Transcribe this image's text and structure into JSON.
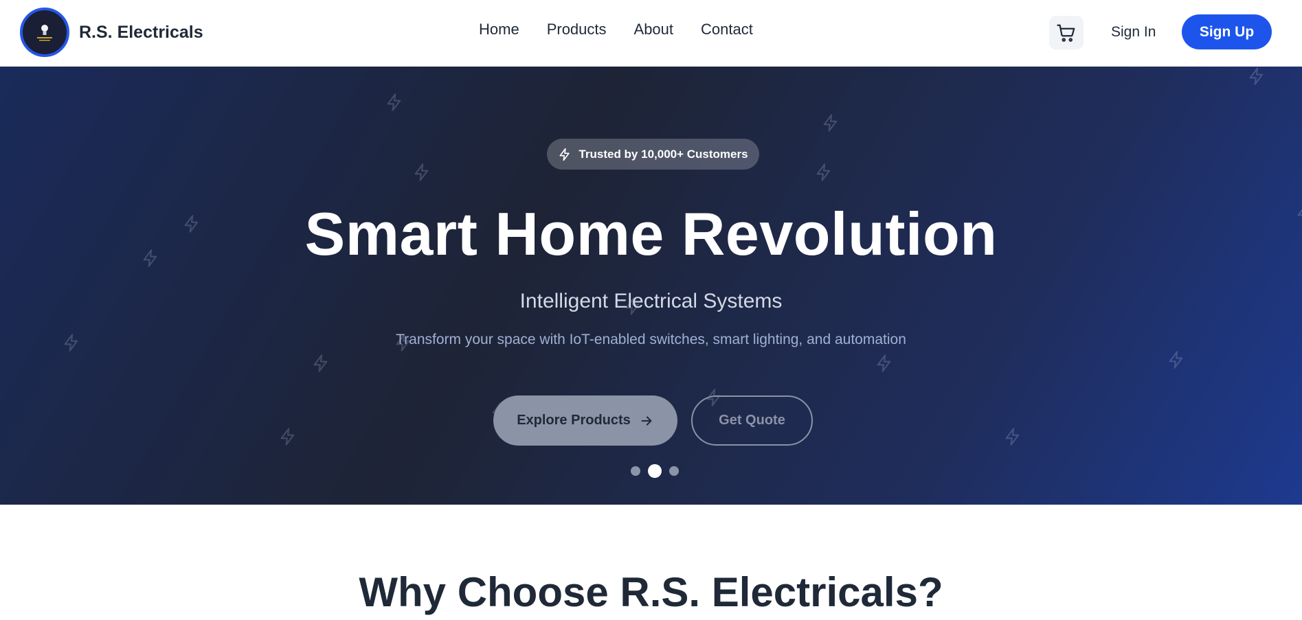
{
  "navbar": {
    "brand_name": "R.S. Electricals",
    "links": [
      "Home",
      "Products",
      "About",
      "Contact"
    ],
    "cart_icon": "cart-icon",
    "signin_label": "Sign In",
    "signup_label": "Sign Up",
    "accent": "#1d55ec"
  },
  "hero": {
    "badge": "Trusted by 10,000+ Customers",
    "title": "Smart Home Revolution",
    "subtitle": "Intelligent Electrical Systems",
    "description": "Transform your space with IoT-enabled switches, smart lighting, and automation",
    "explore_label": "Explore Products",
    "quote_label": "Get Quote",
    "slides": {
      "count": 3,
      "active": 2
    },
    "background_icon": "lightning-bolt-icon"
  },
  "section": {
    "title": "Why Choose R.S. Electricals?"
  }
}
